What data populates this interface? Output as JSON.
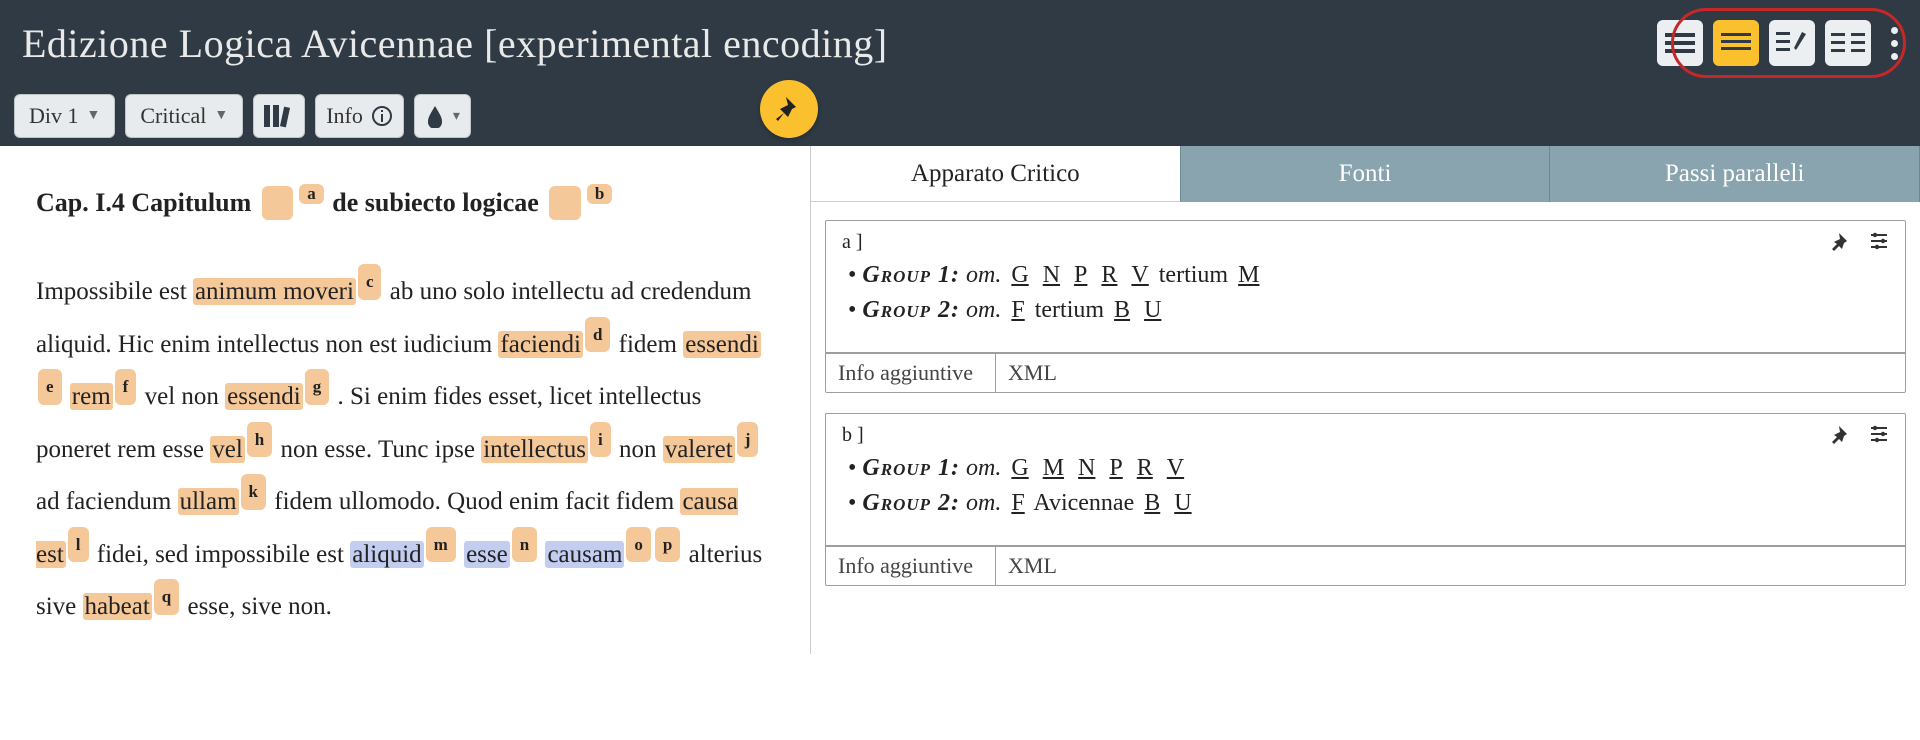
{
  "header": {
    "title": "Edizione Logica Avicennae [experimental encoding]"
  },
  "toolbar": {
    "div": "Div 1",
    "view": "Critical",
    "info": "Info"
  },
  "tabs": {
    "t1": "Apparato Critico",
    "t2": "Fonti",
    "t3": "Passi paralleli"
  },
  "chapter": {
    "ref": "Cap. I.4 Capitulum",
    "note_a": "a",
    "title2": "de subiecto logicae",
    "note_b": "b"
  },
  "text": {
    "t1": "Impossibile est ",
    "w1": "animum moveri",
    "n_c": "c",
    "t2": " ab uno solo intellectu ad credendum aliquid. Hic enim intellectus non est iudicium ",
    "w2": "faciendi",
    "n_d": "d",
    "t3": " fidem ",
    "w3": "essendi",
    "n_e": "e",
    "t4": " ",
    "w4": "rem",
    "n_f": "f",
    "t5": " vel non ",
    "w5": "essendi",
    "n_g": "g",
    "t6": " . Si enim fides esset, licet intellectus poneret rem esse ",
    "w6": "vel",
    "n_h": "h",
    "t7": " non esse. Tunc ipse ",
    "w7": "intellectus",
    "n_i": "i",
    "t8": " non ",
    "w8": "valeret",
    "n_j": "j",
    "t9": " ad faciendum ",
    "w9": "ullam",
    "n_k": "k",
    "t10": " fidem ullomodo. Quod enim facit fidem ",
    "w10": "causa est",
    "n_l": "l",
    "t11": " fidei, sed impossibile est  ",
    "w11": "aliquid",
    "n_m": "m",
    "w12": "esse",
    "n_n": "n",
    "w13": "causam",
    "n_o": "o",
    "n_p": "p",
    "t12": " alterius sive ",
    "w14": "habeat",
    "n_q": "q",
    "t13": " esse, sive non."
  },
  "apparatus": [
    {
      "sig": "a",
      "groups": [
        {
          "label": "Group 1:",
          "om": "om.",
          "witnesses": [
            "G",
            "N",
            "P",
            "R",
            "V"
          ],
          "extra": "tertium",
          "postwit": [
            "M"
          ]
        },
        {
          "label": "Group 2:",
          "om": "om.",
          "witnesses": [
            "F"
          ],
          "extra": "tertium",
          "postwit": [
            "B",
            "U"
          ]
        }
      ],
      "info": "Info aggiuntive",
      "xml": "XML"
    },
    {
      "sig": "b",
      "groups": [
        {
          "label": "Group 1:",
          "om": "om.",
          "witnesses": [
            "G",
            "M",
            "N",
            "P",
            "R",
            "V"
          ],
          "extra": "",
          "postwit": []
        },
        {
          "label": "Group 2:",
          "om": "om.",
          "witnesses": [
            "F"
          ],
          "extra": "Avicennae",
          "postwit": [
            "B",
            "U"
          ]
        }
      ],
      "info": "Info aggiuntive",
      "xml": "XML"
    }
  ]
}
